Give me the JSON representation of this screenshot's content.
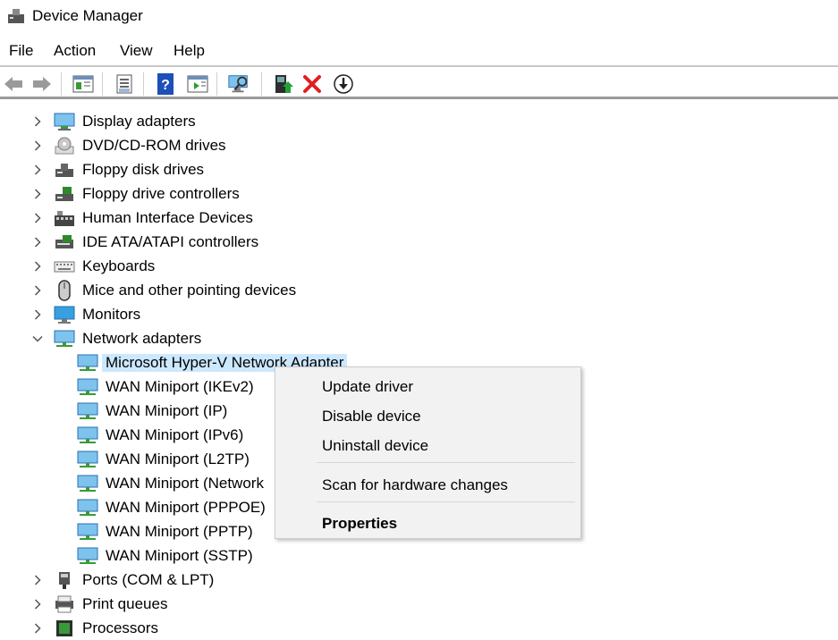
{
  "window": {
    "title": "Device Manager"
  },
  "menubar": {
    "items": [
      "File",
      "Action",
      "View",
      "Help"
    ]
  },
  "toolbar": {
    "buttons": [
      "back-icon",
      "forward-icon",
      "show-hide-console-tree-icon",
      "properties-icon",
      "help-icon",
      "action-pane-icon",
      "scan-hardware-icon",
      "update-driver-icon",
      "uninstall-icon",
      "download-icon"
    ]
  },
  "tree": {
    "categories_top": [
      {
        "label": "Display adapters",
        "icon": "display-adapter-icon"
      },
      {
        "label": "DVD/CD-ROM drives",
        "icon": "dvd-drive-icon"
      },
      {
        "label": "Floppy disk drives",
        "icon": "floppy-disk-icon"
      },
      {
        "label": "Floppy drive controllers",
        "icon": "floppy-controller-icon"
      },
      {
        "label": "Human Interface Devices",
        "icon": "hid-icon"
      },
      {
        "label": "IDE ATA/ATAPI controllers",
        "icon": "ide-controller-icon"
      },
      {
        "label": "Keyboards",
        "icon": "keyboard-icon"
      },
      {
        "label": "Mice and other pointing devices",
        "icon": "mouse-icon"
      },
      {
        "label": "Monitors",
        "icon": "monitor-icon"
      }
    ],
    "expanded": {
      "label": "Network adapters",
      "icon": "network-adapter-icon",
      "children": [
        "Microsoft Hyper-V Network Adapter",
        "WAN Miniport (IKEv2)",
        "WAN Miniport (IP)",
        "WAN Miniport (IPv6)",
        "WAN Miniport (L2TP)",
        "WAN Miniport (Network",
        "WAN Miniport (PPPOE)",
        "WAN Miniport (PPTP)",
        "WAN Miniport (SSTP)"
      ],
      "selected_index": 0
    },
    "categories_bottom": [
      {
        "label": "Ports (COM & LPT)",
        "icon": "port-icon"
      },
      {
        "label": "Print queues",
        "icon": "printer-icon"
      },
      {
        "label": "Processors",
        "icon": "processor-icon"
      }
    ]
  },
  "context_menu": {
    "items": [
      "Update driver",
      "Disable device",
      "Uninstall device",
      "Scan for hardware changes",
      "Properties"
    ]
  },
  "colors": {
    "selection": "#cce8ff",
    "accent_blue": "#2b7bd6",
    "delete_red": "#e02020",
    "green": "#21a336"
  }
}
